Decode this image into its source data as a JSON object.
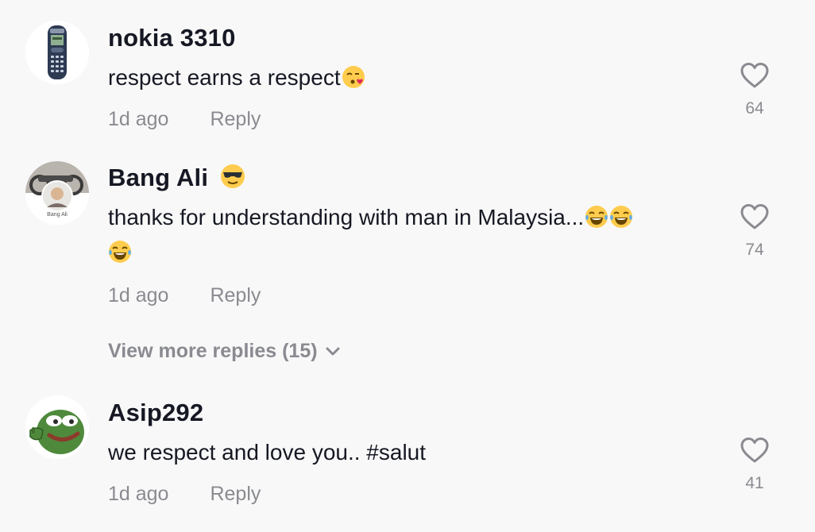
{
  "comments": [
    {
      "username": "nokia 3310",
      "text": "respect earns a respect",
      "time": "1d ago",
      "reply_label": "Reply",
      "likes": "64",
      "avatar_icon": "nokia-phone-icon",
      "text_emoji": [
        "kiss-emoji"
      ]
    },
    {
      "username": "Bang Ali",
      "username_emoji": "sunglasses-emoji",
      "text": "thanks for understanding with man in Malaysia...",
      "time": "1d ago",
      "reply_label": "Reply",
      "likes": "74",
      "avatar_icon": "profile-photo",
      "avatar_caption": "Bang Ali",
      "text_emoji": [
        "laughing-tears-emoji",
        "laughing-tears-emoji",
        "laughing-tears-emoji"
      ]
    },
    {
      "username": "Asip292",
      "text": "we respect and love you.. #salut",
      "time": "1d ago",
      "reply_label": "Reply",
      "likes": "41",
      "avatar_icon": "pepe-frog-icon"
    }
  ],
  "view_more": {
    "label": "View more replies (15)",
    "icon": "chevron-down-icon"
  },
  "colors": {
    "background": "#f8f8f8",
    "primary_text": "#161823",
    "secondary_text": "#8a8b91"
  }
}
